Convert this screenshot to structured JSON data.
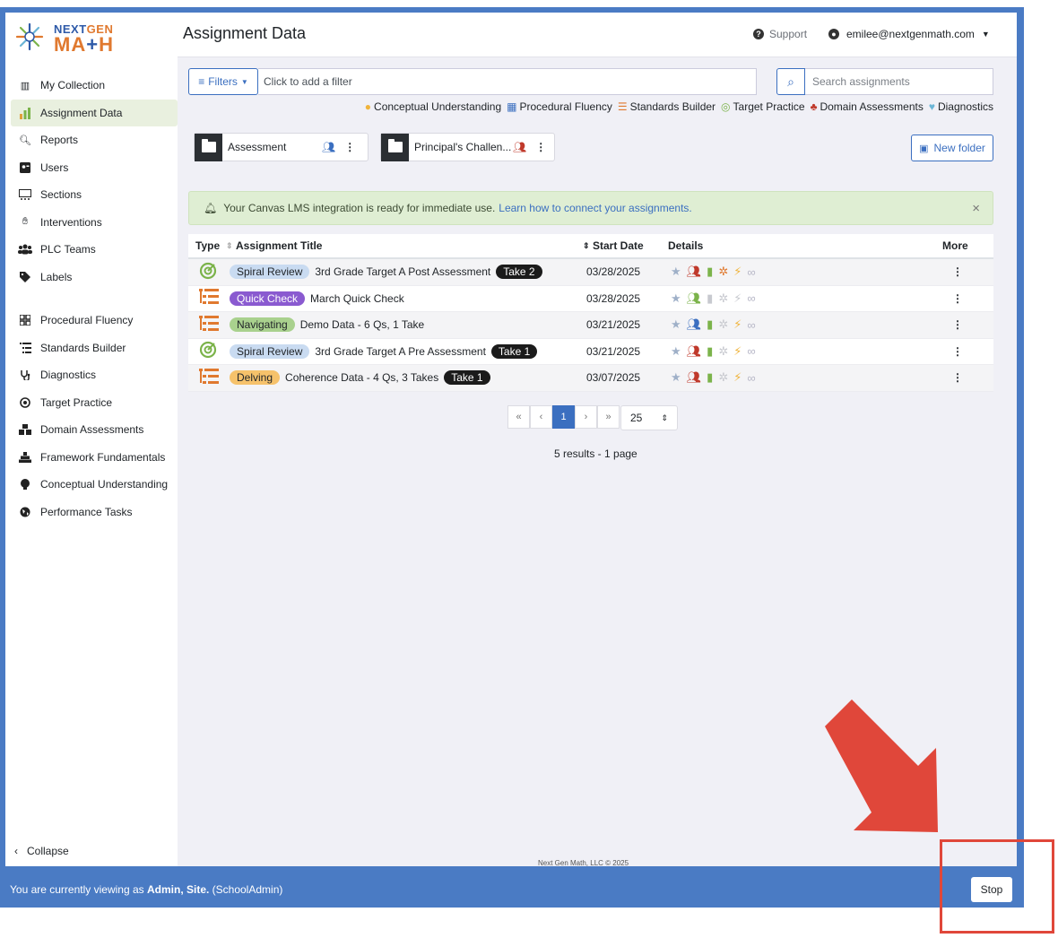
{
  "app": {
    "logo_top_1": "NEXT",
    "logo_top_2": "GEN",
    "logo_bottom_1": "M",
    "logo_bottom_2": "A",
    "logo_bottom_3": "+",
    "logo_bottom_4": "H",
    "page_title": "Assignment Data",
    "support": "Support",
    "user_email": "emilee@nextgenmath.com"
  },
  "sidebar": {
    "items": [
      {
        "label": "My Collection",
        "icon": "books-icon"
      },
      {
        "label": "Assignment Data",
        "icon": "bar-chart-icon",
        "active": true
      },
      {
        "label": "Reports",
        "icon": "search-icon"
      },
      {
        "label": "Users",
        "icon": "user-card-icon"
      },
      {
        "label": "Sections",
        "icon": "sections-icon"
      },
      {
        "label": "Interventions",
        "icon": "hand-icon"
      },
      {
        "label": "PLC Teams",
        "icon": "team-icon"
      },
      {
        "label": "Labels",
        "icon": "tag-icon"
      }
    ],
    "items2": [
      {
        "label": "Procedural Fluency",
        "icon": "grid-icon"
      },
      {
        "label": "Standards Builder",
        "icon": "list-icon"
      },
      {
        "label": "Diagnostics",
        "icon": "stethoscope-icon"
      },
      {
        "label": "Target Practice",
        "icon": "target-icon"
      },
      {
        "label": "Domain Assessments",
        "icon": "cubes-icon"
      },
      {
        "label": "Framework Fundamentals",
        "icon": "pyramid-icon"
      },
      {
        "label": "Conceptual Understanding",
        "icon": "bulb-icon"
      },
      {
        "label": "Performance Tasks",
        "icon": "globe-icon"
      }
    ],
    "collapse": "Collapse"
  },
  "toolbar": {
    "filters_label": "Filters",
    "filter_placeholder": "Click to add a filter",
    "search_placeholder": "Search assignments",
    "legend": [
      "Conceptual Understanding",
      "Procedural Fluency",
      "Standards Builder",
      "Target Practice",
      "Domain Assessments",
      "Diagnostics"
    ]
  },
  "folders": [
    {
      "name": "Assessment"
    },
    {
      "name": "Principal's Challen..."
    }
  ],
  "new_folder": "New folder",
  "alert": {
    "text": "Your Canvas LMS integration is ready for immediate use.",
    "link": "Learn how to connect your assignments."
  },
  "table": {
    "headers": {
      "type": "Type",
      "title": "Assignment Title",
      "date": "Start Date",
      "details": "Details",
      "more": "More"
    },
    "rows": [
      {
        "type_icon": "target-icon",
        "pill": "Spiral Review",
        "pill_color": "#c9dbf1",
        "pill_text_color": "#212529",
        "title": "3rd Grade Target A Post Assessment",
        "take": "Take 2",
        "date": "03/28/2025"
      },
      {
        "type_icon": "list-icon",
        "pill": "Quick Check",
        "pill_color": "#8a5ad0",
        "pill_text_color": "#ffffff",
        "title": "March Quick Check",
        "take": "",
        "date": "03/28/2025"
      },
      {
        "type_icon": "list-icon",
        "pill": "Navigating",
        "pill_color": "#a9d18e",
        "pill_text_color": "#212529",
        "title": "Demo Data - 6 Qs, 1 Take",
        "take": "",
        "date": "03/21/2025"
      },
      {
        "type_icon": "target-icon",
        "pill": "Spiral Review",
        "pill_color": "#c9dbf1",
        "pill_text_color": "#212529",
        "title": "3rd Grade Target A Pre Assessment",
        "take": "Take 1",
        "date": "03/21/2025"
      },
      {
        "type_icon": "list-icon",
        "pill": "Delving",
        "pill_color": "#f6c26b",
        "pill_text_color": "#212529",
        "title": "Coherence Data - 4 Qs, 3 Takes",
        "take": "Take 1",
        "date": "03/07/2025"
      }
    ]
  },
  "pagination": {
    "first": "«",
    "prev": "‹",
    "current": "1",
    "next": "›",
    "last": "»",
    "per_page": "25",
    "results": "5 results - 1 page"
  },
  "footer": "Next Gen Math, LLC © 2025",
  "bottom_bar": {
    "prefix": "You are currently viewing as ",
    "name": "Admin, Site.",
    "role": " (SchoolAdmin)",
    "stop": "Stop"
  },
  "colors": {
    "accent": "#3b6fc0",
    "bar": "#4a7bc4",
    "annotation": "#e0473a"
  }
}
